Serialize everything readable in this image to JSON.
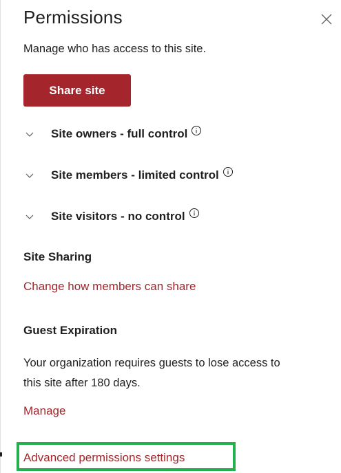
{
  "panel": {
    "title": "Permissions",
    "subtitle": "Manage who has access to this site.",
    "close_icon": "close-icon",
    "share_button": "Share site"
  },
  "groups": [
    {
      "label": "Site owners - full control",
      "icon": "chevron-down-icon",
      "info_icon": "info-icon"
    },
    {
      "label": "Site members - limited control",
      "icon": "chevron-down-icon",
      "info_icon": "info-icon"
    },
    {
      "label": "Site visitors - no control",
      "icon": "chevron-down-icon",
      "info_icon": "info-icon"
    }
  ],
  "site_sharing": {
    "heading": "Site Sharing",
    "link": "Change how members can share"
  },
  "guest_expiration": {
    "heading": "Guest Expiration",
    "text": "Your organization requires guests to lose access to this site after 180 days.",
    "link": "Manage"
  },
  "advanced": {
    "link": "Advanced permissions settings"
  },
  "colors": {
    "accent": "#a4262c",
    "highlight": "#22b14c",
    "text": "#201f1e"
  }
}
